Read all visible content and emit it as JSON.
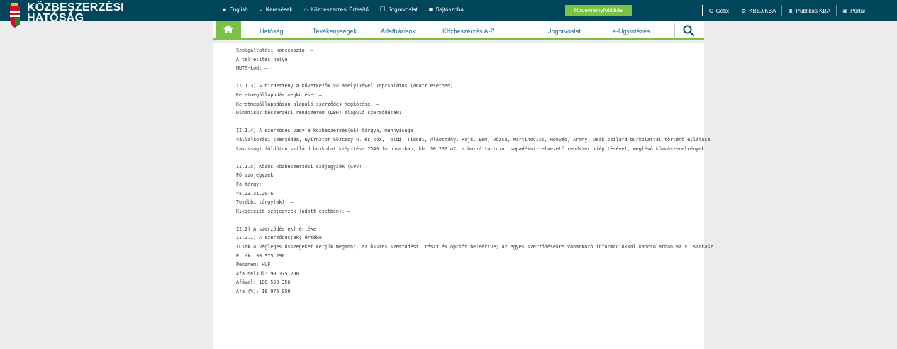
{
  "header": {
    "logo_line1": "KÖZBESZERZÉSI",
    "logo_line2": "HATÓSÁG",
    "top_links": [
      {
        "icon": "globe-icon",
        "label": "English"
      },
      {
        "icon": "search-icon",
        "label": "Keresések"
      },
      {
        "icon": "home-icon",
        "label": "Közbeszerzési Értesítő"
      },
      {
        "icon": "document-icon",
        "label": "Jogorvoslat"
      },
      {
        "icon": "folder-icon",
        "label": "Sajtószoba"
      }
    ],
    "green_button": "Hirdetményfeltöltés",
    "right_links": [
      {
        "icon": "c-icon",
        "label": "Cetix"
      },
      {
        "icon": "gear-icon",
        "label": "KBEJ/KBA"
      },
      {
        "icon": "user-icon",
        "label": "Publikus KBA"
      },
      {
        "icon": "person-icon",
        "label": "Portál"
      }
    ]
  },
  "nav": {
    "items": [
      "Hatóság",
      "Tevékenységek",
      "Adatbázisok",
      "Közbeszerzés A-Z",
      "Jogorvoslat",
      "e-Ügyintézés"
    ]
  },
  "content": {
    "lines": [
      "Szolgáltatási koncesszió: –",
      "A teljesítés helye: –",
      "NUTS-kód: –",
      "",
      "II.1.3) A hirdetmény a következők valamelyikével kapcsolatos (adott esetben)",
      "Keretmegállapodás megkötése: –",
      "Keretmegállapodáson alapuló szerződés megkötése: –",
      "Dinamikus beszerzési rendszeren (DBR) alapuló szerződések: –",
      "",
      "II.1.4) A szerződés vagy a közbeszerzés(ek) tárgya, mennyisége",
      "Vállalkozási szerződés, Nyírhátor közcsoy u. és köz, Toldi, Tisódi, Alkotmány, Rajk, Bem, Dózsa, Martinovics, Honvéd, Arany, Deák szilárd burkolattal történő ellátása",
      "Lakossági földúton szilárd burkolat kiépítése 2540 fm hosszban, kb. 10 200 m2, a hozzá tartozó csapadékvíz-elvezető rendszer kiépítésével, meglévő közműszerelvények",
      "",
      "II.1.5) Közös közbeszerzési szójegyzék (CPV)",
      "Fő szójegyzék",
      "Fő tárgy:",
      "45.23.31.20-6",
      "További tárgy(ak): –",
      "Kiegészítő szójegyzék (adott esetben): –",
      "",
      "II.2) A szerződés(ek) értéke",
      "II.2.1) A szerződés(ek) értéke",
      "(Csak a végleges összegeket kérjük megadni, az összes szerződést, részt és opciót beleértve; az egyes szerződésekre vonatkozó információkkal kapcsolatban az V. szakasz",
      "Érték: 90 375 296",
      "Pénznem: HUF",
      "Áfa nélkül: 90 375 296",
      "Áfával: 100 550 356",
      "Áfa (%): 18 975 059"
    ]
  }
}
